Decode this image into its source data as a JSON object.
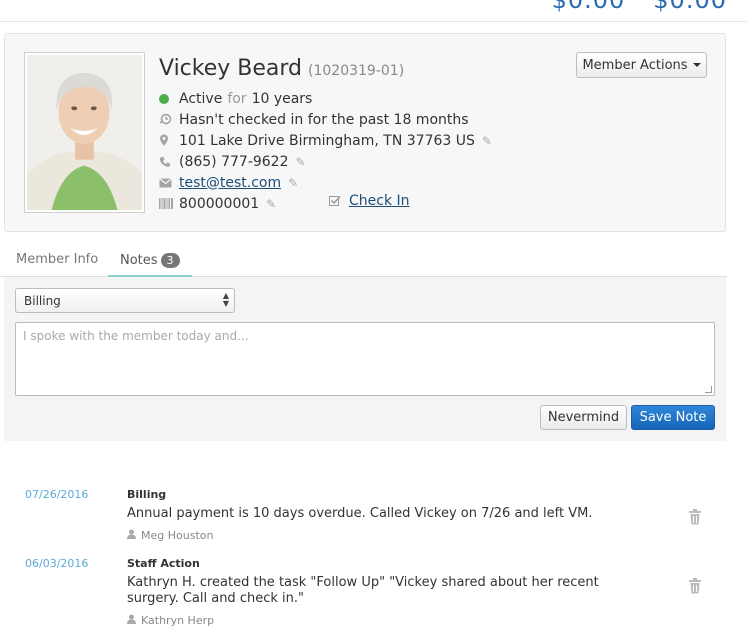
{
  "top": {
    "amount_left": "$0.00",
    "amount_right": "$0.00"
  },
  "member": {
    "name": "Vickey Beard",
    "id": "(1020319-01)",
    "status": "Active",
    "status_for": "for",
    "status_duration": "10 years",
    "checkin_notice": "Hasn't checked in for the past 18 months",
    "address": "101 Lake Drive Birmingham, TN 37763 US",
    "phone": "(865) 777-9622",
    "email": "test@test.com",
    "barcode": "800000001",
    "checkin_label": "Check In",
    "actions_label": "Member Actions",
    "status_color": "#4cae4c"
  },
  "tabs": [
    {
      "label": "Member Info"
    },
    {
      "label": "Notes",
      "count": "3"
    }
  ],
  "note_form": {
    "category": "Billing",
    "placeholder": "I spoke with the member today and...",
    "cancel_label": "Nevermind",
    "save_label": "Save Note"
  },
  "notes": [
    {
      "date": "07/26/2016",
      "category": "Billing",
      "text": "Annual payment is 10 days overdue. Called Vickey on 7/26 and left VM.",
      "author": "Meg Houston"
    },
    {
      "date": "06/03/2016",
      "category": "Staff Action",
      "text": "Kathryn H. created the task \"Follow Up\" \"Vickey shared about her recent surgery. Call and check in.\"",
      "author": "Kathryn Herp"
    }
  ],
  "colors": {
    "accent": "#1565b8",
    "date": "#5aa9d6",
    "tab_underline": "#8fd0c4"
  }
}
